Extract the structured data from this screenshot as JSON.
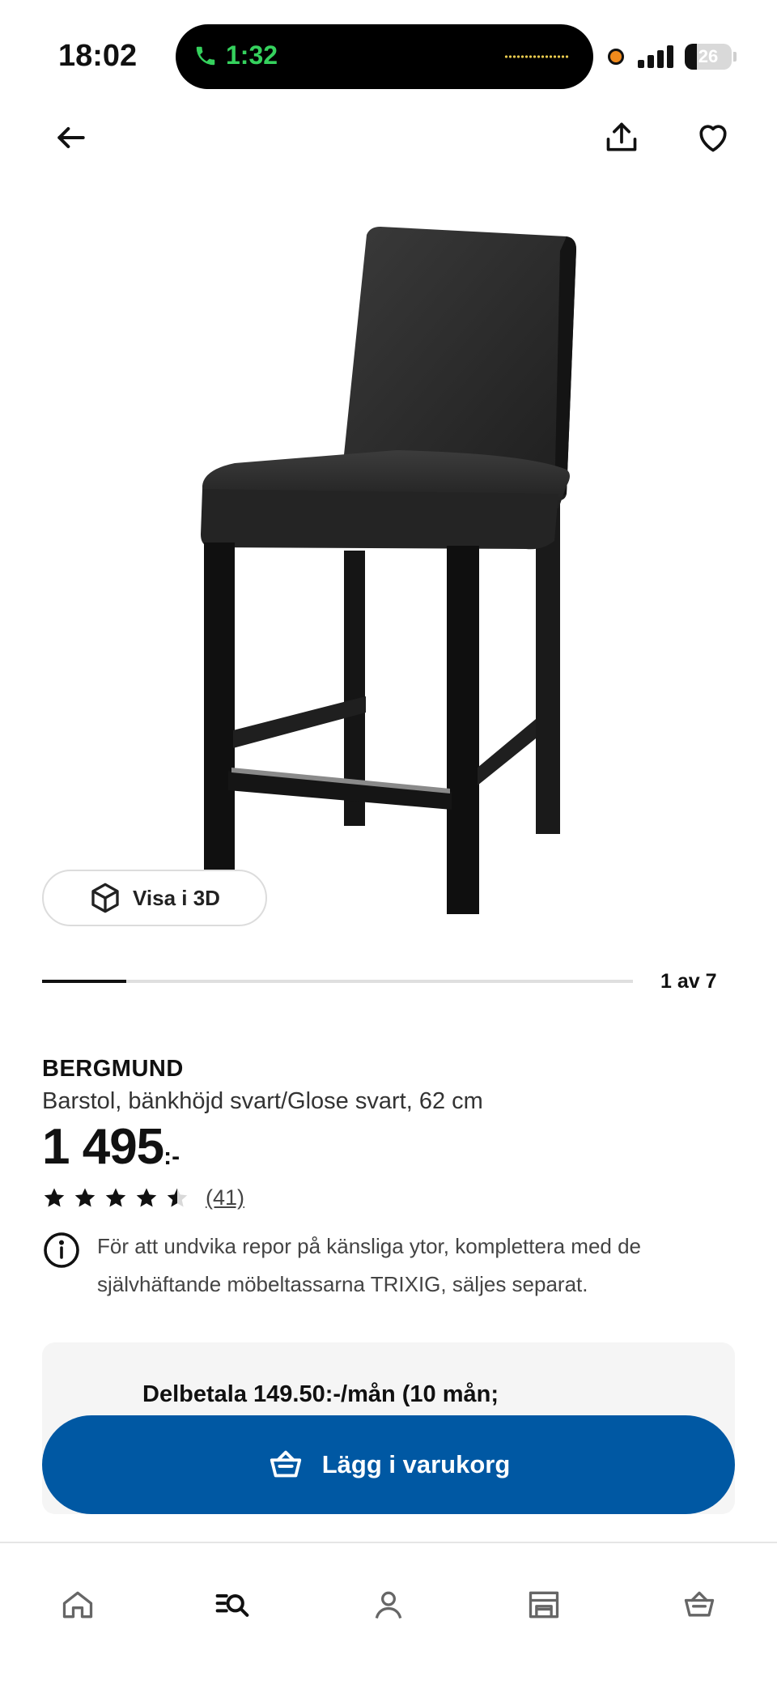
{
  "status_bar": {
    "time": "18:02",
    "call_timer": "1:32",
    "battery_level": 26,
    "battery_text": "26"
  },
  "product": {
    "name": "BERGMUND",
    "description": "Barstol, bänkhöjd svart/Glose svart, 62 cm",
    "price": "1 495",
    "price_suffix": ":-",
    "rating": 4.5,
    "max_rating": 5,
    "reviews_count": "(41)",
    "notice": "För att undvika repor på känsliga ytor, komplettera med de självhäftande möbeltassarna TRIXIG, säljes separat."
  },
  "gallery": {
    "view_3d_label": "Visa i 3D",
    "current": 1,
    "total": 7,
    "position_label": "1 av 7"
  },
  "payment": {
    "text": "Delbetala 149.50:-/mån (10 mån;"
  },
  "cart": {
    "button_label": "Lägg i varukorg"
  },
  "bottom_nav": {
    "items": [
      "home-icon",
      "search-icon",
      "profile-icon",
      "store-icon",
      "cart-icon"
    ],
    "active": "search-icon"
  },
  "colors": {
    "primary_blue": "#0058a3",
    "text": "#111111",
    "call_green": "#35d15d"
  }
}
